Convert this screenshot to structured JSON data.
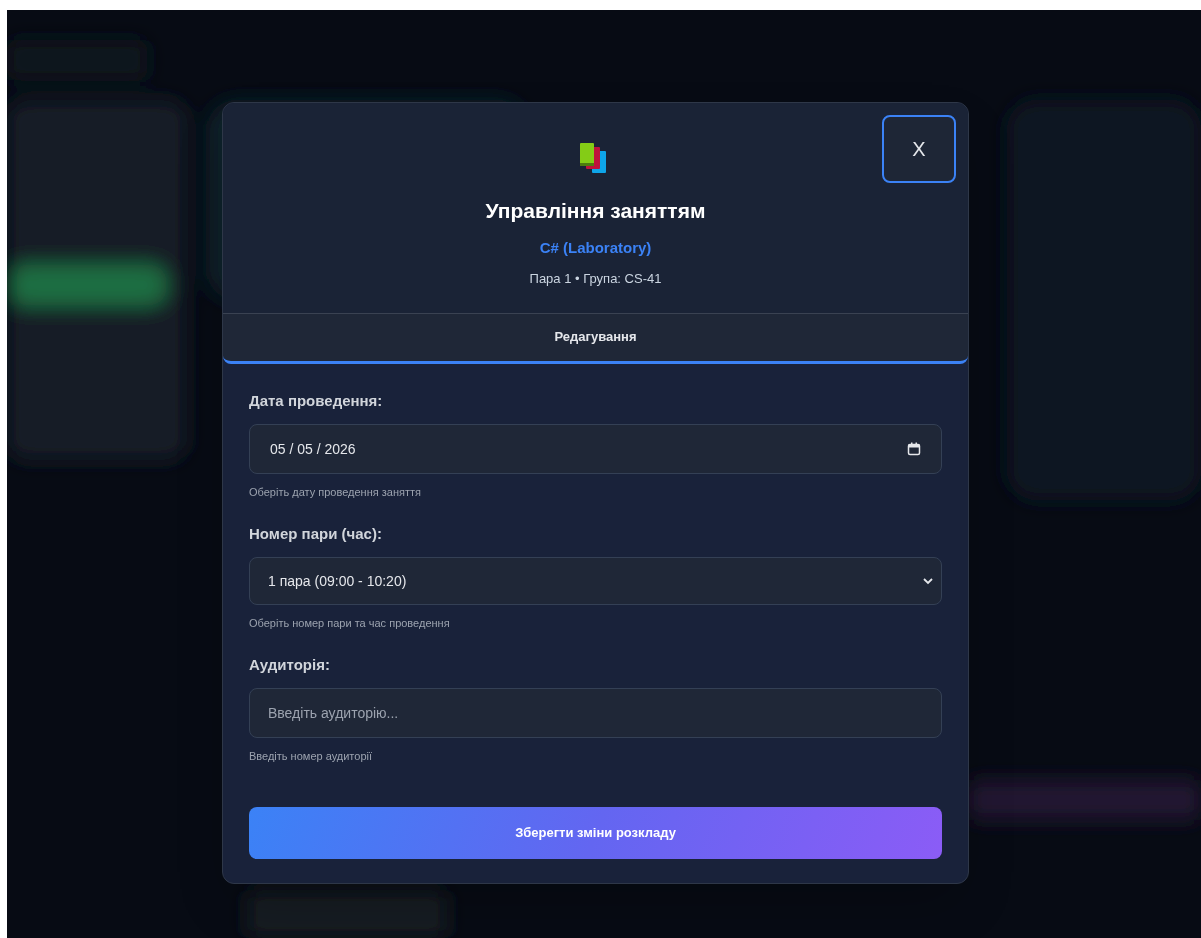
{
  "dialog": {
    "title": "Управління заняттям",
    "subject": "C# (Laboratory)",
    "meta": "Пара 1 • Група: CS-41",
    "close_label": "X"
  },
  "tabs": [
    {
      "label": "Редагування",
      "selected": true
    }
  ],
  "fields": [
    {
      "kind": "date",
      "label": "Дата проведення:",
      "value": "05 / 05 / 2026",
      "hint": "Оберіть дату проведення заняття"
    },
    {
      "kind": "select",
      "label": "Номер пари (час):",
      "value": "1 пара (09:00 - 10:20)",
      "hint": "Оберіть номер пари та час проведення"
    },
    {
      "kind": "text",
      "label": "Аудиторія:",
      "placeholder": "Введіть аудиторію...",
      "hint": "Введіть номер аудиторії"
    }
  ],
  "submit": "Зберегти зміни розкладу"
}
